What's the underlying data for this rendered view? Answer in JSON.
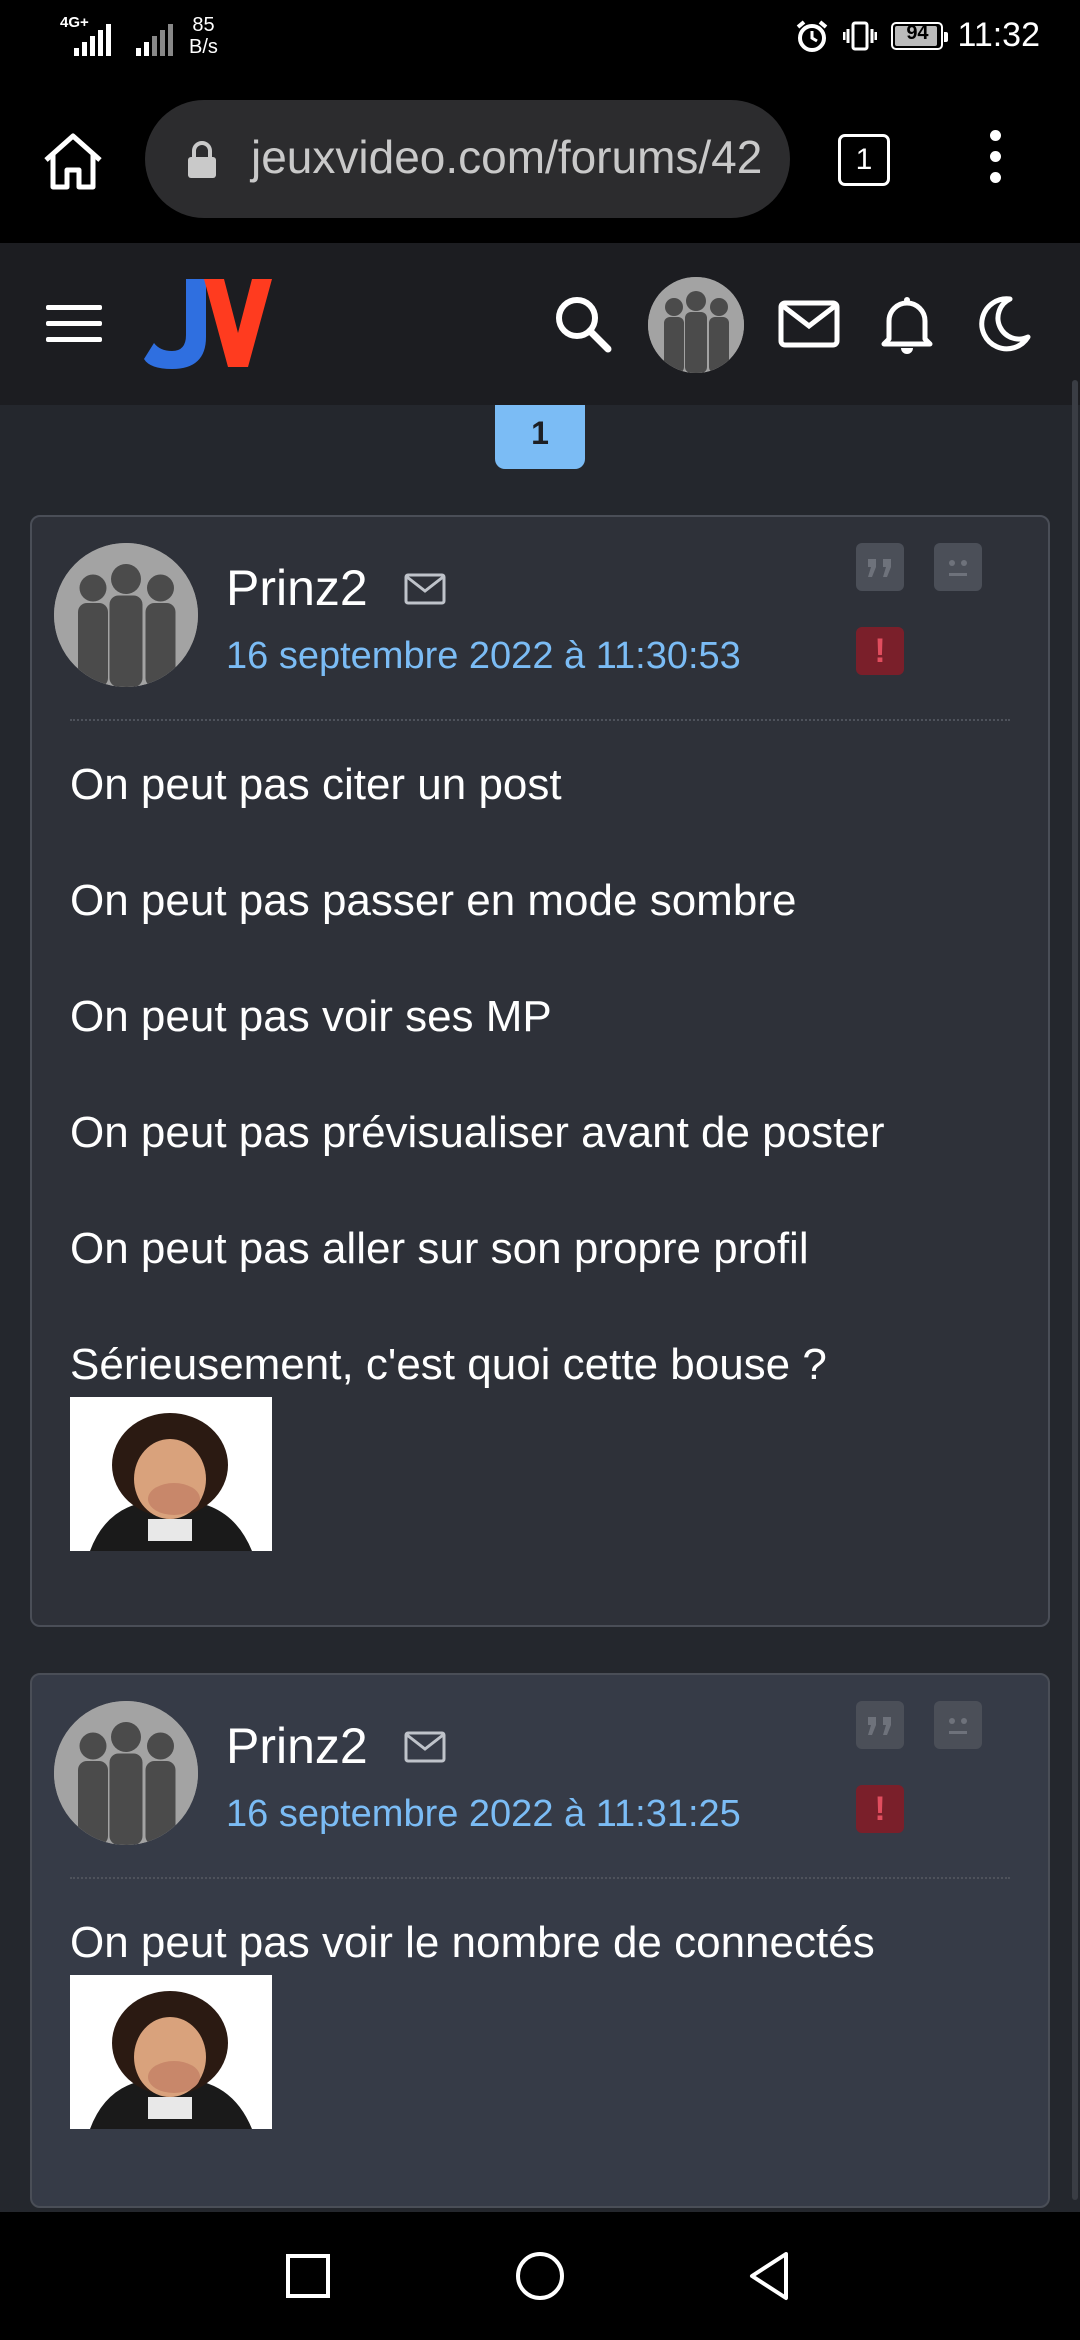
{
  "status_bar": {
    "network": "4G+",
    "speed_value": "85",
    "speed_unit": "B/s",
    "battery": "94",
    "time": "11:32",
    "icons": [
      "signal-icon",
      "signal-icon",
      "alarm-icon",
      "vibrate-icon",
      "battery-icon"
    ]
  },
  "browser": {
    "url": "jeuxvideo.com/forums/42",
    "tab_count": "1",
    "icons": [
      "home-icon",
      "lock-icon",
      "tabs-icon",
      "more-vert-icon"
    ]
  },
  "site_header": {
    "logo": "JV",
    "icons": [
      "hamburger-icon",
      "search-icon",
      "avatar",
      "mail-icon",
      "bell-icon",
      "moon-icon"
    ]
  },
  "pagination": {
    "current_page": "1"
  },
  "posts": [
    {
      "author": "Prinz2",
      "date": "16 septembre 2022 à 11:30:53",
      "lines": [
        "On peut pas citer un post",
        "On peut pas passer en mode sombre",
        "On peut pas voir ses MP",
        "On peut pas prévisualiser avant de poster",
        "On peut pas aller sur son propre profil",
        "Sérieusement, c'est quoi cette bouse ?"
      ],
      "alert_label": "!"
    },
    {
      "author": "Prinz2",
      "date": "16 septembre 2022 à 11:31:25",
      "lines": [
        "On peut pas voir le nombre de connectés"
      ],
      "alert_label": "!"
    }
  ],
  "colors": {
    "page_bg": "#24272d",
    "accent_blue": "#7bbcf5",
    "logo_blue": "#2f6fe0",
    "logo_red": "#ff3b1f"
  }
}
